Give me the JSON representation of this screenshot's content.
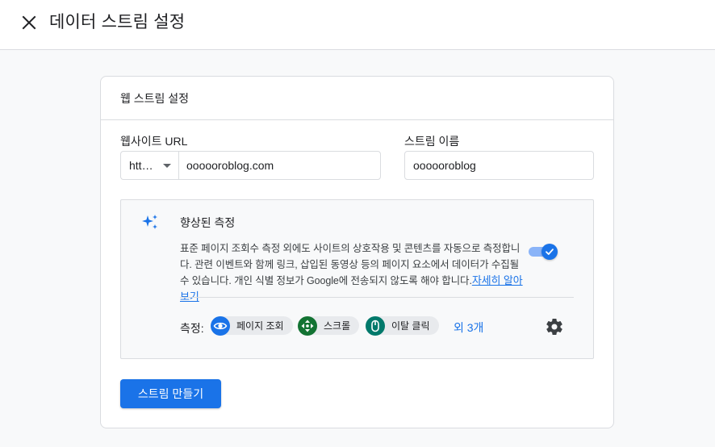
{
  "header": {
    "title": "데이터 스트림 설정"
  },
  "card": {
    "title": "웹 스트림 설정",
    "website_url": {
      "label": "웹사이트 URL",
      "protocol": "htt…",
      "value": "oooooroblog.com"
    },
    "stream_name": {
      "label": "스트림 이름",
      "value": "oooooroblog"
    },
    "enhanced_measurement": {
      "title": "향상된 측정",
      "description": "표준 페이지 조회수 측정 외에도 사이트의 상호작용 및 콘텐츠를 자동으로 측정합니다. 관련 이벤트와 함께 링크, 삽입된 동영상 등의 페이지 요소에서 데이터가 수집될 수 있습니다. 개인 식별 정보가 Google에 전송되지 않도록 해야 합니다.",
      "learn_more": "자세히 알아보기",
      "enabled": true,
      "measurements_label": "측정:",
      "chips": [
        {
          "label": "페이지 조회",
          "icon": "eye-icon",
          "color": "#1a73e8"
        },
        {
          "label": "스크롤",
          "icon": "move-arrows-icon",
          "color": "#137333"
        },
        {
          "label": "이탈 클릭",
          "icon": "mouse-icon",
          "color": "#00796b"
        }
      ],
      "more": "외 3개"
    },
    "create_button": "스트림 만들기"
  },
  "colors": {
    "accent": "#1a73e8",
    "toggle_track": "#8ab4f8",
    "border": "#dadce0"
  }
}
